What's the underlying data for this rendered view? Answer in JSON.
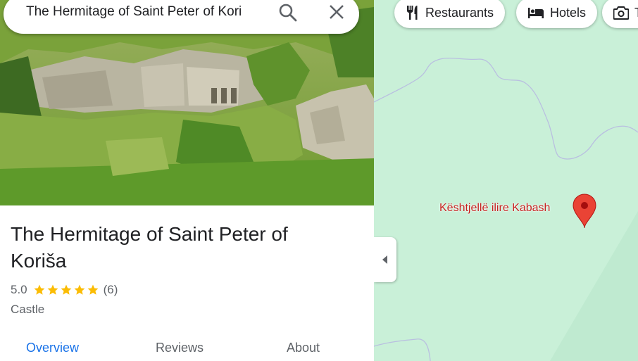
{
  "search": {
    "query": "The Hermitage of Saint Peter of Kori"
  },
  "place": {
    "title": "The Hermitage of Saint Peter of Koriša",
    "rating": "5.0",
    "stars": 5,
    "review_count": "(6)",
    "category": "Castle"
  },
  "tabs": [
    {
      "label": "Overview",
      "active": true
    },
    {
      "label": "Reviews",
      "active": false
    },
    {
      "label": "About",
      "active": false
    }
  ],
  "map": {
    "chips": [
      {
        "label": "Restaurants",
        "icon": "fork-knife-icon"
      },
      {
        "label": "Hotels",
        "icon": "bed-icon"
      },
      {
        "label": "T",
        "icon": "camera-icon"
      }
    ],
    "marker_label": "Kështjellë ilire Kabash"
  },
  "colors": {
    "accent": "#1a73e8",
    "star": "#fbbc04",
    "marker": "#ea4335",
    "marker_label": "#c5221f",
    "map_bg": "#c9f0d8"
  }
}
